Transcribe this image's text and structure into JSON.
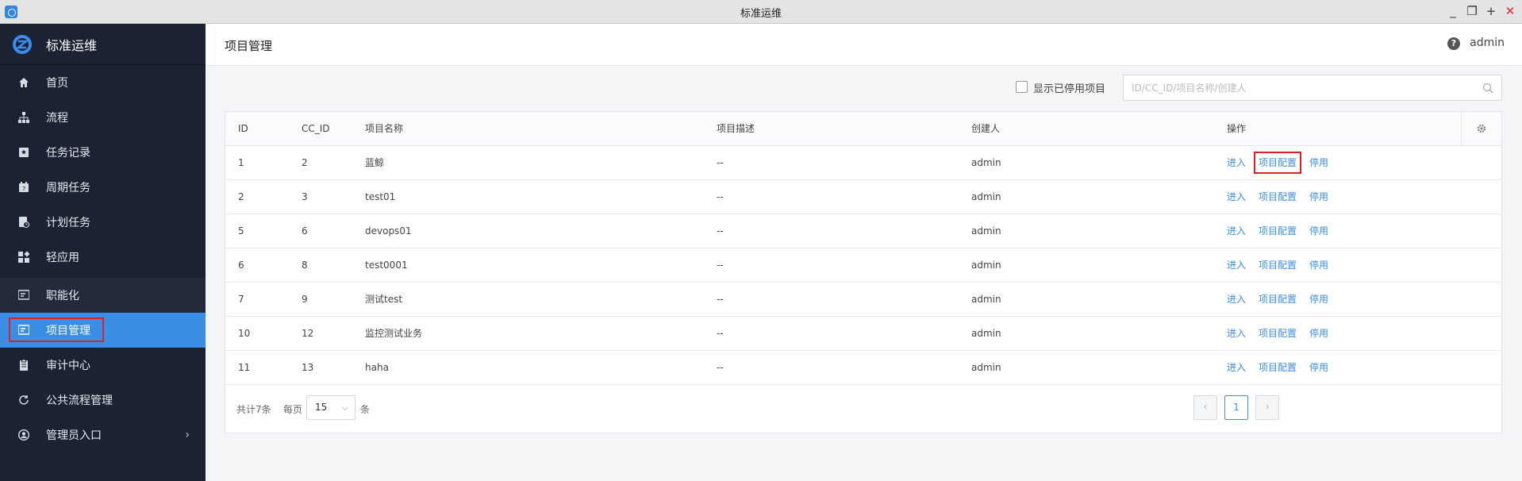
{
  "window": {
    "title": "标准运维",
    "controls": [
      "_",
      "❐",
      "+",
      "✕"
    ]
  },
  "brand": {
    "name": "标准运维"
  },
  "sidebar": {
    "items": [
      {
        "label": "首页",
        "icon": "home-icon"
      },
      {
        "label": "流程",
        "icon": "flow-icon"
      },
      {
        "label": "任务记录",
        "icon": "task-record-icon"
      },
      {
        "label": "周期任务",
        "icon": "calendar-icon"
      },
      {
        "label": "计划任务",
        "icon": "plan-icon"
      },
      {
        "label": "轻应用",
        "icon": "apps-icon"
      },
      {
        "label": "职能化",
        "icon": "function-icon"
      },
      {
        "label": "项目管理",
        "icon": "project-icon"
      },
      {
        "label": "审计中心",
        "icon": "audit-icon"
      },
      {
        "label": "公共流程管理",
        "icon": "refresh-icon"
      },
      {
        "label": "管理员入口",
        "icon": "user-circle-icon"
      }
    ],
    "active": "项目管理"
  },
  "header": {
    "title": "项目管理",
    "user": "admin",
    "help": "?"
  },
  "filters": {
    "show_disabled_label": "显示已停用项目",
    "show_disabled_checked": false,
    "search_placeholder": "ID/CC_ID/项目名称/创建人",
    "search_value": ""
  },
  "table": {
    "columns": [
      "ID",
      "CC_ID",
      "项目名称",
      "项目描述",
      "创建人",
      "操作"
    ],
    "actions": {
      "enter": "进入",
      "config": "项目配置",
      "disable": "停用"
    },
    "rows": [
      {
        "id": "1",
        "cc_id": "2",
        "name": "蓝鲸",
        "desc": "--",
        "creator": "admin"
      },
      {
        "id": "2",
        "cc_id": "3",
        "name": "test01",
        "desc": "--",
        "creator": "admin"
      },
      {
        "id": "5",
        "cc_id": "6",
        "name": "devops01",
        "desc": "--",
        "creator": "admin"
      },
      {
        "id": "6",
        "cc_id": "8",
        "name": "test0001",
        "desc": "--",
        "creator": "admin"
      },
      {
        "id": "7",
        "cc_id": "9",
        "name": "测试test",
        "desc": "--",
        "creator": "admin"
      },
      {
        "id": "10",
        "cc_id": "12",
        "name": "监控测试业务",
        "desc": "--",
        "creator": "admin"
      },
      {
        "id": "11",
        "cc_id": "13",
        "name": "haha",
        "desc": "--",
        "creator": "admin"
      }
    ]
  },
  "pagination": {
    "total_label": "共计7条",
    "per_page_label": "每页",
    "per_page_value": "15",
    "unit_label": "条",
    "current_page": "1",
    "prev": "‹",
    "next": "›"
  },
  "colors": {
    "sidebar_bg": "#1b2231",
    "active": "#3a8ee6",
    "link": "#3a8ee6",
    "highlight": "#e02020"
  }
}
